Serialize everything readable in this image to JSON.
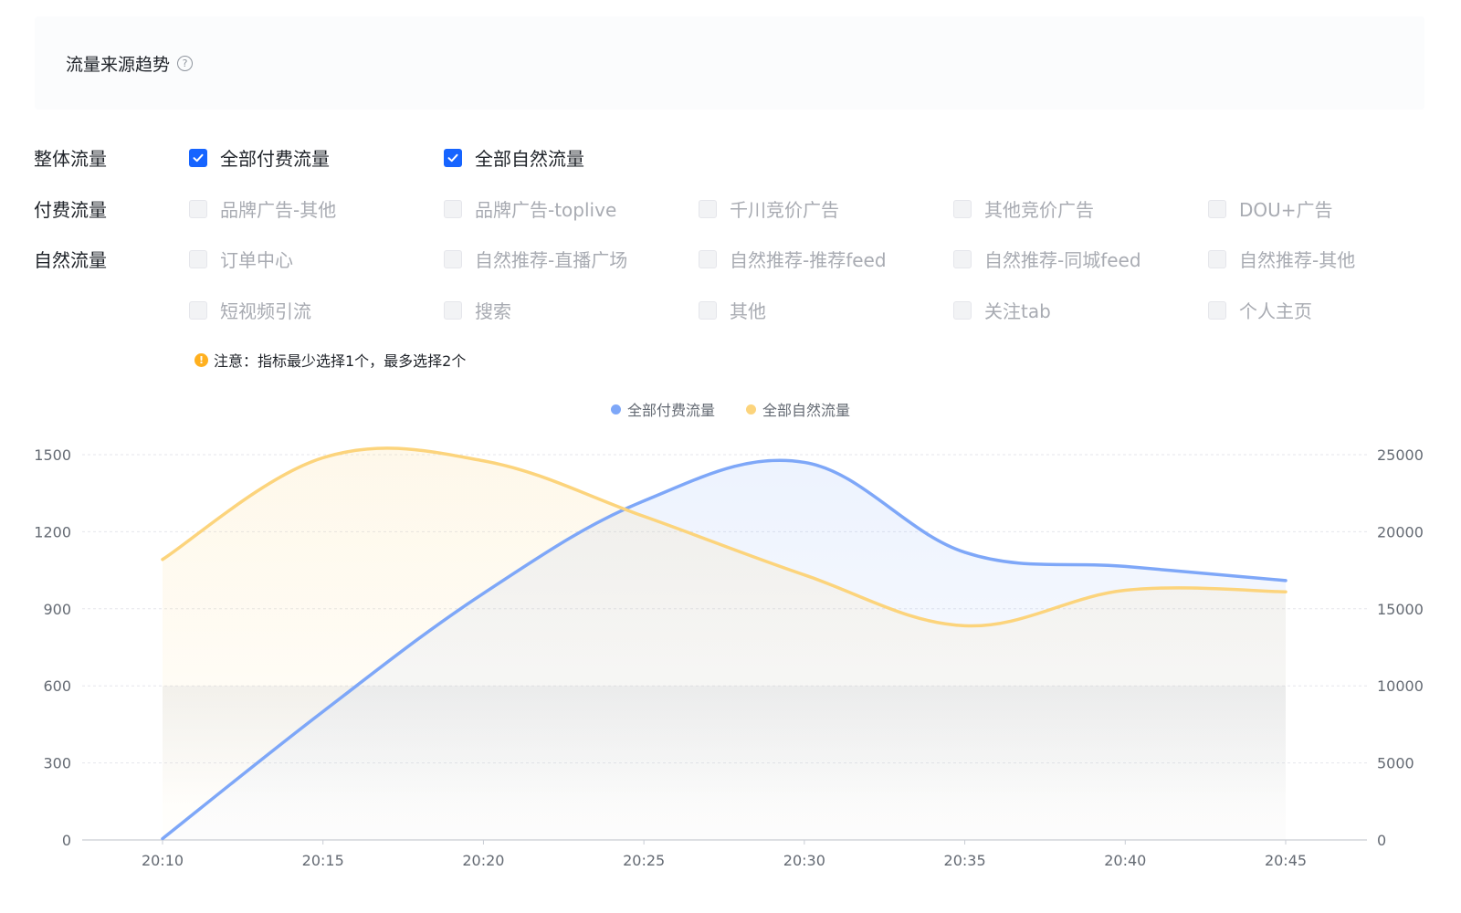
{
  "page": {
    "title": "流量来源趋势",
    "help_icon": "?"
  },
  "filters": {
    "rows": [
      {
        "label": "整体流量",
        "options": [
          {
            "label": "全部付费流量",
            "checked": true,
            "enabled": true
          },
          {
            "label": "全部自然流量",
            "checked": true,
            "enabled": true
          }
        ]
      },
      {
        "label": "付费流量",
        "options": [
          {
            "label": "品牌广告-其他",
            "checked": false,
            "enabled": false
          },
          {
            "label": "品牌广告-toplive",
            "checked": false,
            "enabled": false
          },
          {
            "label": "千川竞价广告",
            "checked": false,
            "enabled": false
          },
          {
            "label": "其他竞价广告",
            "checked": false,
            "enabled": false
          },
          {
            "label": "DOU+广告",
            "checked": false,
            "enabled": false
          }
        ]
      },
      {
        "label": "自然流量",
        "options": [
          {
            "label": "订单中心",
            "checked": false,
            "enabled": false
          },
          {
            "label": "自然推荐-直播广场",
            "checked": false,
            "enabled": false
          },
          {
            "label": "自然推荐-推荐feed",
            "checked": false,
            "enabled": false
          },
          {
            "label": "自然推荐-同城feed",
            "checked": false,
            "enabled": false
          },
          {
            "label": "自然推荐-其他",
            "checked": false,
            "enabled": false
          },
          {
            "label": "短视频引流",
            "checked": false,
            "enabled": false
          },
          {
            "label": "搜索",
            "checked": false,
            "enabled": false
          },
          {
            "label": "其他",
            "checked": false,
            "enabled": false
          },
          {
            "label": "关注tab",
            "checked": false,
            "enabled": false
          },
          {
            "label": "个人主页",
            "checked": false,
            "enabled": false
          }
        ]
      }
    ],
    "notice": "注意：指标最少选择1个，最多选择2个",
    "notice_icon": "!"
  },
  "colors": {
    "checkbox_checked": "#1664ff",
    "paid": "#7ea7f8",
    "natural": "#fcd47c",
    "warning": "#ffb01f"
  },
  "chart_data": {
    "type": "line",
    "x": [
      "20:10",
      "20:15",
      "20:20",
      "20:25",
      "20:30",
      "20:35",
      "20:40",
      "20:45"
    ],
    "series": [
      {
        "name": "全部付费流量",
        "axis": "left",
        "color": "#7ea7f8",
        "values": [
          5,
          500,
          960,
          1320,
          1470,
          1120,
          1065,
          1010
        ]
      },
      {
        "name": "全部自然流量",
        "axis": "right",
        "color": "#fcd47c",
        "values": [
          18200,
          24800,
          24600,
          21000,
          17200,
          13900,
          16200,
          16100
        ]
      }
    ],
    "y_left": {
      "ticks": [
        "0",
        "300",
        "600",
        "900",
        "1200",
        "1500"
      ],
      "min": 0,
      "max": 1500
    },
    "y_right": {
      "ticks": [
        "0",
        "5000",
        "10000",
        "15000",
        "20000",
        "25000"
      ],
      "min": 0,
      "max": 25000
    },
    "legend": "top-center",
    "grid": true
  }
}
